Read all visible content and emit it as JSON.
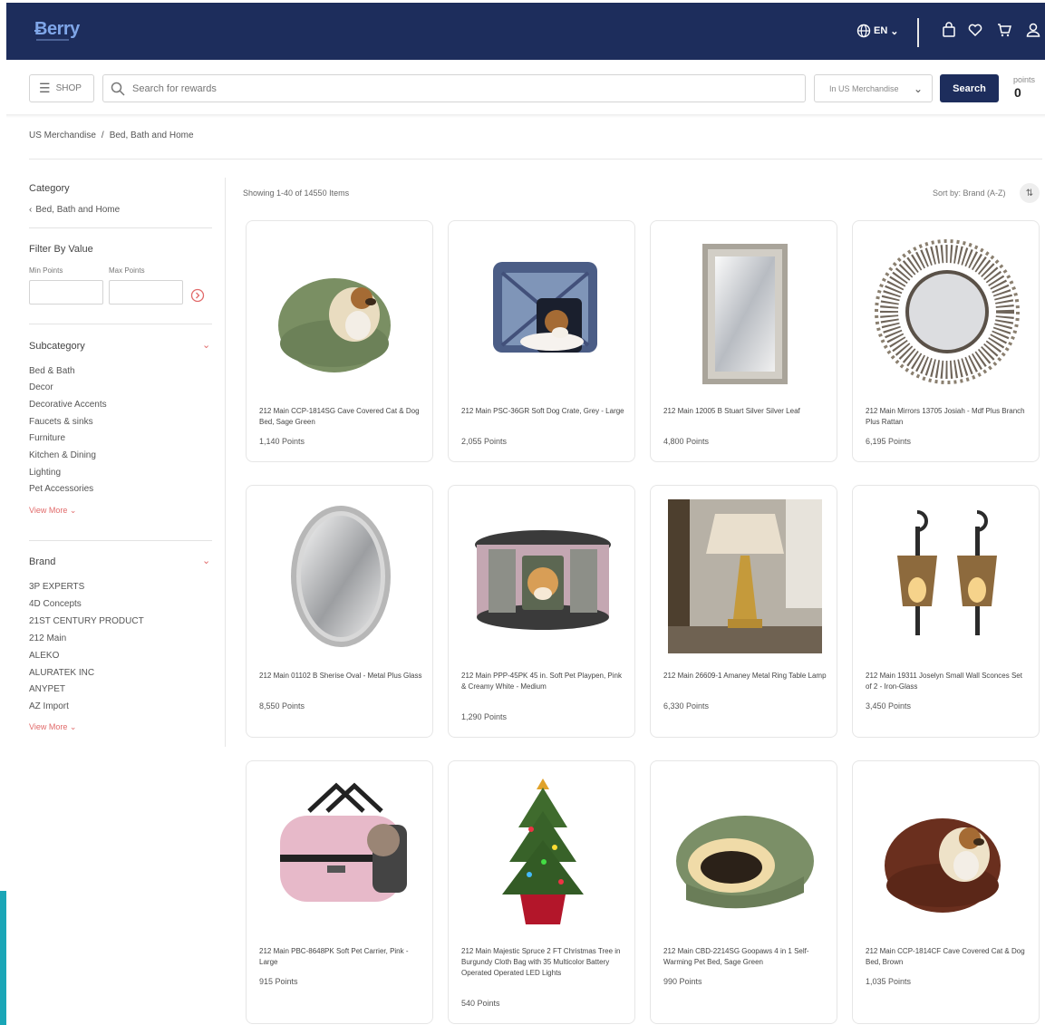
{
  "brand": {
    "logo_text": "Ƀerry",
    "colors": {
      "nav": "#1d2d5c",
      "accent": "#e16a6a"
    }
  },
  "topnav": {
    "language": "EN",
    "icons": [
      "globe-icon",
      "bag-icon",
      "heart-icon",
      "cart-icon",
      "user-icon"
    ]
  },
  "searchbar": {
    "shop_label": "SHOP",
    "placeholder": "Search for rewards",
    "scope": "In US Merchandise",
    "search_label": "Search",
    "points_label": "points",
    "points_value": "0"
  },
  "breadcrumb": {
    "items": [
      "US Merchandise",
      "/",
      "Bed, Bath and Home"
    ]
  },
  "sidebar": {
    "category_title": "Category",
    "category_back": "Bed, Bath and Home",
    "filter_title": "Filter By Value",
    "min_label": "Min Points",
    "max_label": "Max Points",
    "subcategory_title": "Subcategory",
    "subcategories": [
      "Bed & Bath",
      "Decor",
      "Decorative Accents",
      "Faucets & sinks",
      "Furniture",
      "Kitchen & Dining",
      "Lighting",
      "Pet Accessories"
    ],
    "subcategory_more": "View More",
    "brand_title": "Brand",
    "brands": [
      "3P EXPERTS",
      "4D Concepts",
      "21ST CENTURY PRODUCT",
      "212 Main",
      "ALEKO",
      "ALURATEK INC",
      "ANYPET",
      "AZ Import"
    ],
    "brand_more": "View More"
  },
  "results": {
    "showing": "Showing 1-40 of 14550 Items",
    "sort": "Sort by: Brand (A-Z)"
  },
  "products": [
    {
      "name": "212 Main CCP-1814SG Cave Covered Cat & Dog Bed, Sage Green",
      "points": "1,140 Points",
      "image": "green-cave-pet-bed"
    },
    {
      "name": "212 Main PSC-36GR Soft Dog Crate, Grey - Large",
      "points": "2,055 Points",
      "image": "grey-dog-crate"
    },
    {
      "name": "212 Main 12005 B Stuart Silver Silver Leaf",
      "points": "4,800 Points",
      "image": "silver-rectangular-mirror"
    },
    {
      "name": "212 Main Mirrors 13705 Josiah - Mdf Plus Branch Plus Rattan",
      "points": "6,195 Points",
      "image": "rattan-sunburst-mirror"
    },
    {
      "name": "212 Main 01102 B Sherise Oval - Metal Plus Glass",
      "points": "8,550 Points",
      "image": "oval-mirror"
    },
    {
      "name": "212 Main PPP-45PK 45 in. Soft Pet Playpen, Pink & Creamy White - Medium",
      "points": "1,290 Points",
      "image": "pink-pet-playpen"
    },
    {
      "name": "212 Main 26609-1 Amaney Metal Ring Table Lamp",
      "points": "6,330 Points",
      "image": "metal-ring-table-lamp"
    },
    {
      "name": "212 Main 19311 Joselyn Small Wall Sconces Set of 2 - Iron-Glass",
      "points": "3,450 Points",
      "image": "wall-sconces"
    },
    {
      "name": "212 Main PBC-8648PK Soft Pet Carrier, Pink - Large",
      "points": "915 Points",
      "image": "pink-pet-carrier"
    },
    {
      "name": "212 Main Majestic Spruce 2 FT Christmas Tree in Burgundy Cloth Bag with 35 Multicolor Battery Operated Operated LED Lights",
      "points": "540 Points",
      "image": "mini-christmas-tree"
    },
    {
      "name": "212 Main CBD-2214SG Goopaws 4 in 1 Self-Warming Pet Bed, Sage Green",
      "points": "990 Points",
      "image": "sherpa-pet-bed"
    },
    {
      "name": "212 Main CCP-1814CF Cave Covered Cat & Dog Bed, Brown",
      "points": "1,035 Points",
      "image": "brown-cave-pet-bed"
    }
  ]
}
